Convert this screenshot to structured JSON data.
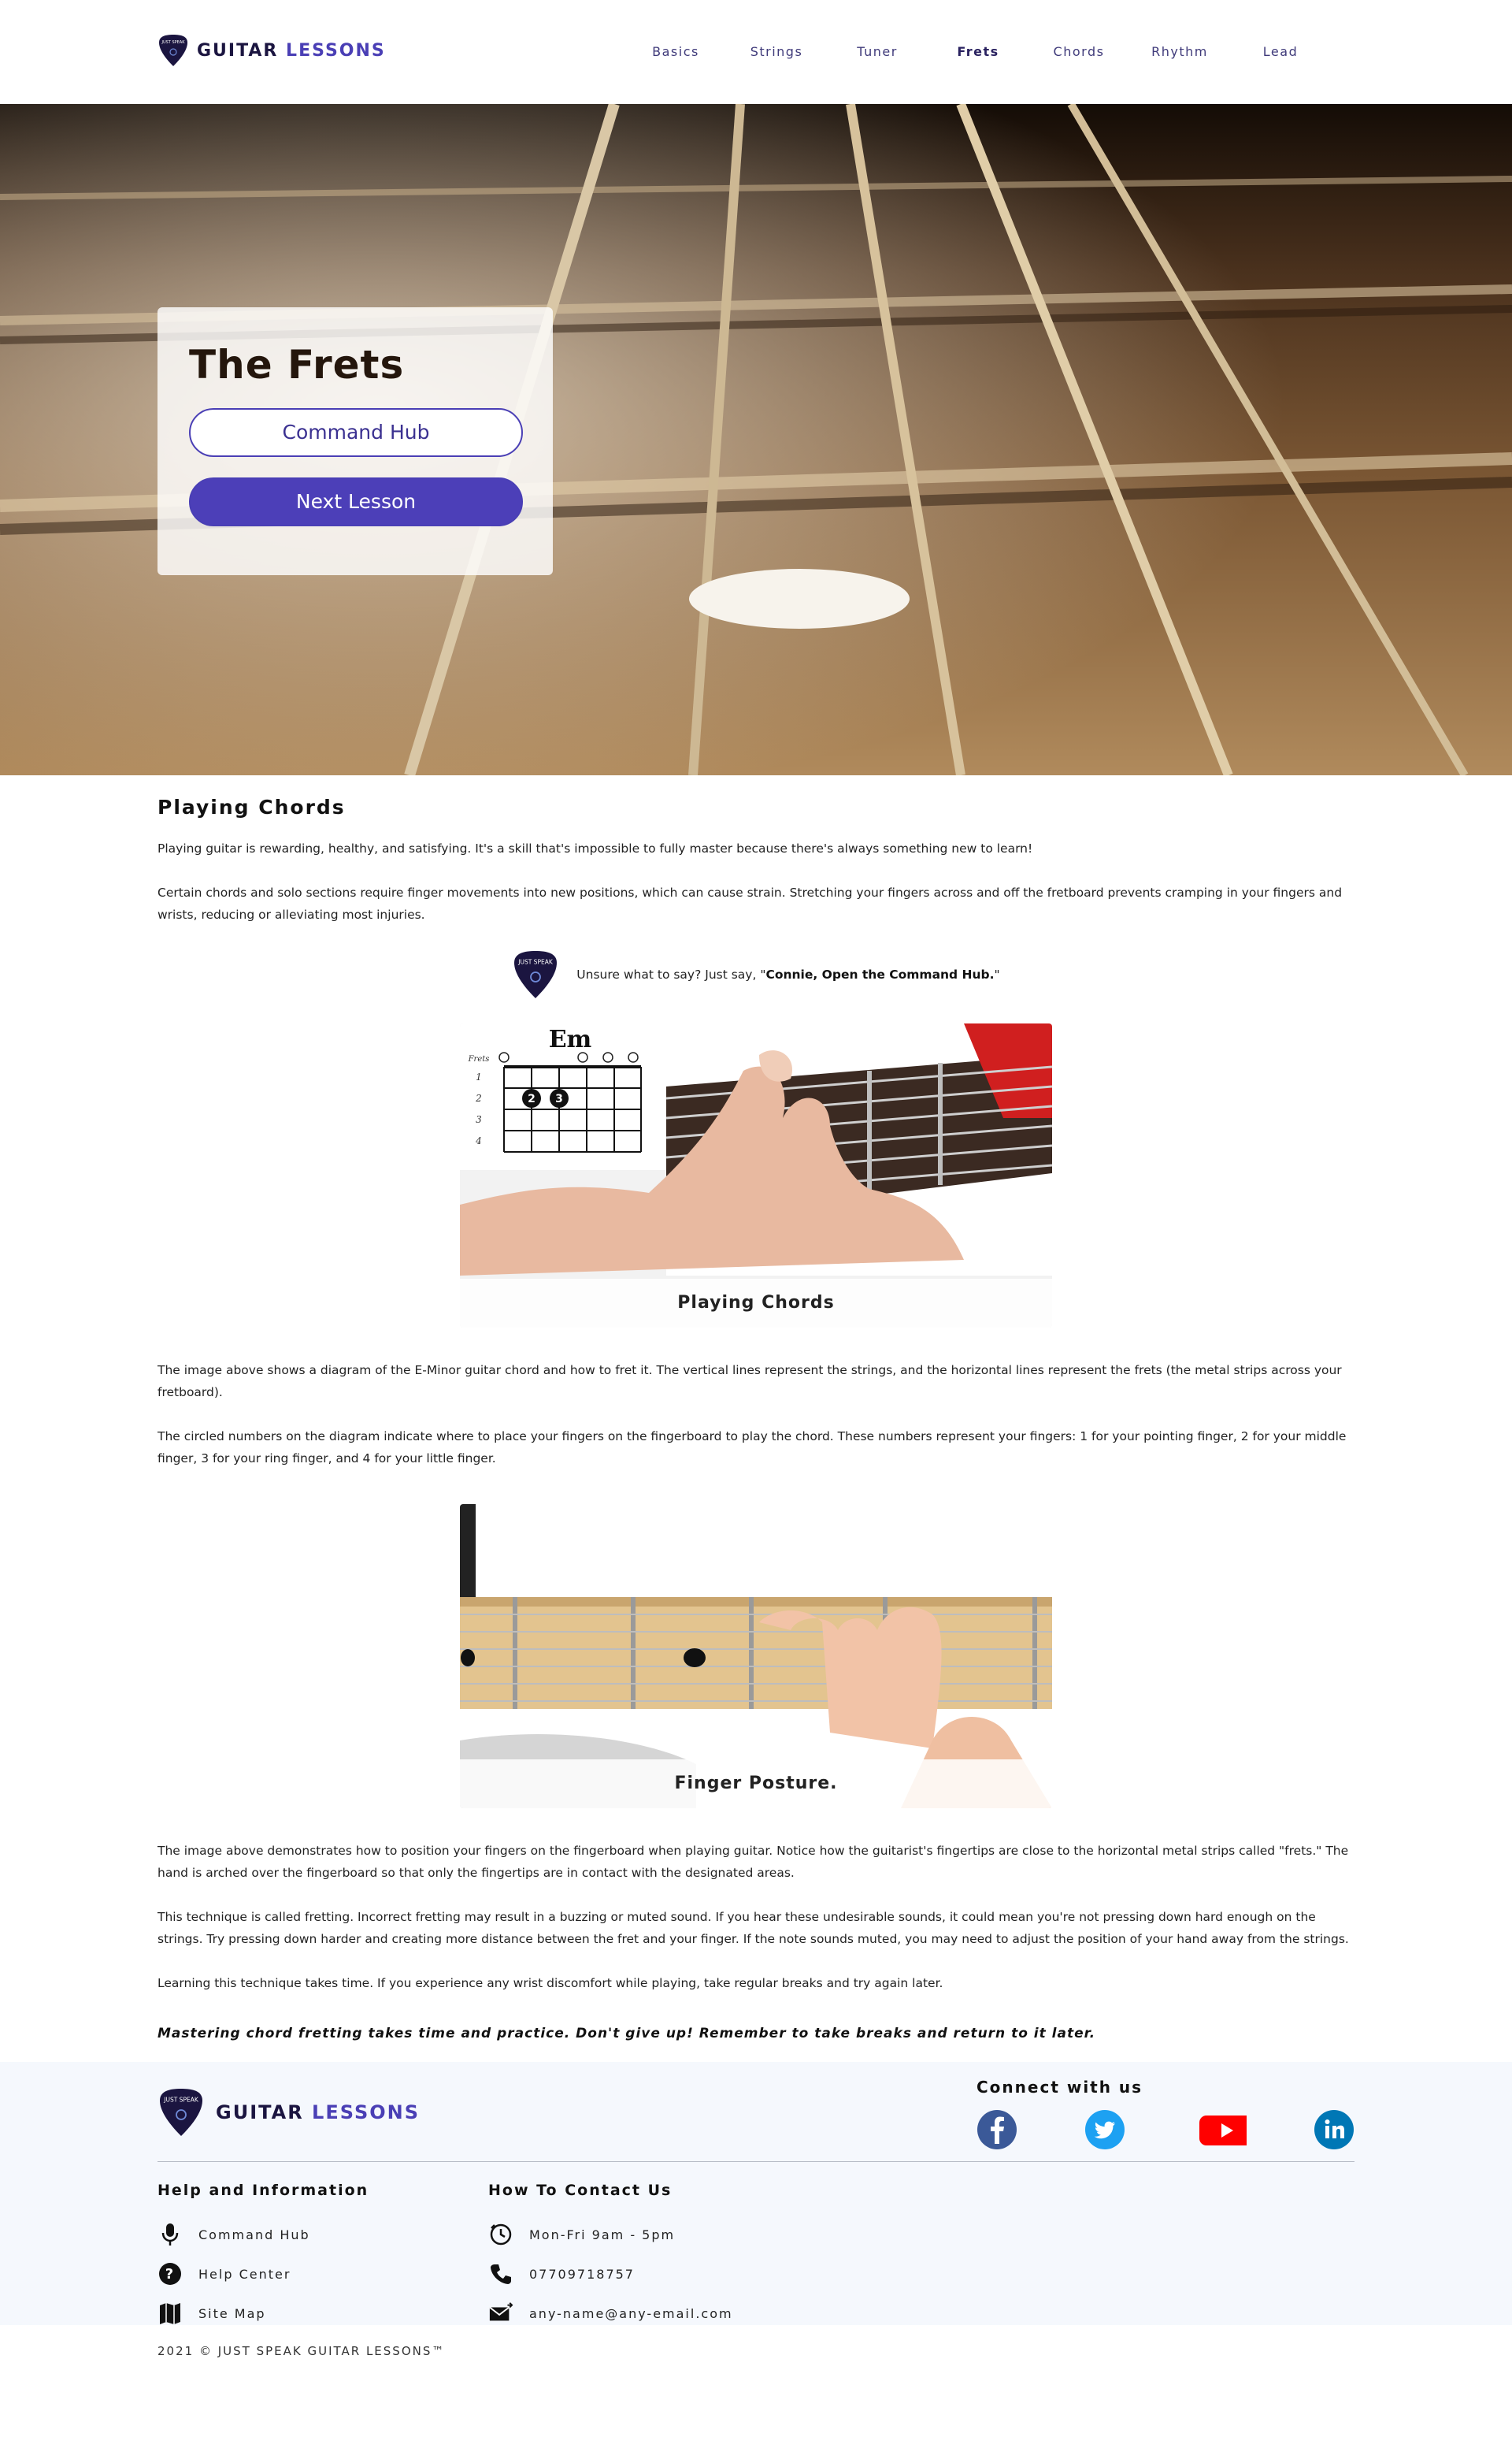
{
  "header": {
    "logo_main": "GUITAR",
    "logo_accent": "LESSONS",
    "logo_pick_text": "JUST SPEAK",
    "nav": [
      {
        "label": "Basics"
      },
      {
        "label": "Strings"
      },
      {
        "label": "Tuner"
      },
      {
        "label": "Frets"
      },
      {
        "label": "Chords"
      },
      {
        "label": "Rhythm"
      },
      {
        "label": "Lead"
      }
    ],
    "active_nav": "Frets"
  },
  "hero": {
    "title": "The Frets",
    "button_primary_outline": "Command Hub",
    "button_next": "Next Lesson"
  },
  "main": {
    "section_title": "Playing Chords",
    "intro_paragraphs": [
      "Playing guitar is rewarding, healthy, and satisfying. It's a skill that's impossible to fully master because there's always something new to learn!",
      "Certain chords and solo sections require finger movements into new positions, which can cause strain. Stretching your fingers across and off the fretboard prevents cramping in your fingers and wrists, reducing or alleviating most injuries."
    ],
    "tip_prefix": "Unsure what to say? Just say, \"",
    "tip_command": "Connie, Open the Command Hub.",
    "tip_suffix": "\"",
    "figure1": {
      "caption": "Playing Chords",
      "chord_name": "Em",
      "frets_label": "Frets",
      "fret_numbers": [
        "1",
        "2",
        "3",
        "4"
      ],
      "finger_numbers": [
        "2",
        "3"
      ]
    },
    "middle_paragraphs": [
      "The image above shows a diagram of the E-Minor guitar chord and how to fret it. The vertical lines represent the strings, and the horizontal lines represent the frets (the metal strips across your fretboard).",
      "The circled numbers on the diagram indicate where to place your fingers on the fingerboard to play the chord. These numbers represent your fingers: 1 for your pointing finger, 2 for your middle finger, 3 for your ring finger, and 4 for your little finger."
    ],
    "figure2": {
      "caption": "Finger Posture."
    },
    "end_paragraphs": [
      "The image above demonstrates how to position your fingers on the fingerboard when playing guitar. Notice how the guitarist's fingertips are close to the horizontal metal strips called \"frets.\" The hand is arched over the fingerboard so that only the fingertips are in contact with the designated areas.",
      "This technique is called fretting. Incorrect fretting may result in a buzzing or muted sound. If you hear these undesirable sounds, it could mean you're not pressing down hard enough on the strings. Try pressing down harder and creating more distance between the fret and your finger. If the note sounds muted, you may need to adjust the position of your hand away from the strings.",
      "Learning this technique takes time. If you experience any wrist discomfort while playing, take regular breaks and try again later."
    ],
    "closing_quote": "Mastering chord fretting takes time and practice. Don't give up! Remember to take breaks and return to it later."
  },
  "footer": {
    "logo_main": "GUITAR",
    "logo_accent": "LESSONS",
    "connect_title": "Connect with us",
    "socials": [
      {
        "icon": "facebook-icon",
        "color": "#3b5998"
      },
      {
        "icon": "twitter-icon",
        "color": "#1da1f2"
      },
      {
        "icon": "youtube-icon",
        "color": "#ff0000"
      },
      {
        "icon": "linkedin-icon",
        "color": "#0077b5"
      }
    ],
    "help_title": "Help and Information",
    "help_items": [
      {
        "icon": "microphone-icon",
        "label": "Command Hub"
      },
      {
        "icon": "question-icon",
        "label": "Help Center"
      },
      {
        "icon": "map-icon",
        "label": "Site Map"
      }
    ],
    "contact_title": "How To Contact Us",
    "contact_items": [
      {
        "icon": "clock-icon",
        "label": "Mon-Fri 9am - 5pm"
      },
      {
        "icon": "phone-icon",
        "label": "07709718757"
      },
      {
        "icon": "email-icon",
        "label": "any-name@any-email.com"
      }
    ],
    "copyright": "2021 © JUST SPEAK GUITAR LESSONS™"
  },
  "colors": {
    "brand": "#4c3fb8",
    "brand_dark": "#1b1540",
    "footer_bg": "#f5f8fd"
  }
}
